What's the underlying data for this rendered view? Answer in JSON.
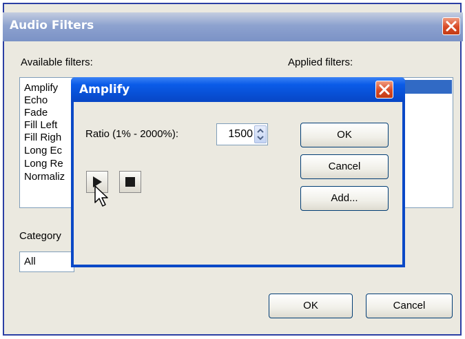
{
  "outer": {
    "title": "Audio Filters",
    "available_label": "Available filters:",
    "applied_label": "Applied filters:",
    "available_filters": [
      "Amplify",
      "Echo",
      "Fade",
      "Fill Left",
      "Fill Righ",
      "Long Ec",
      "Long Re",
      "Normaliz"
    ],
    "category_label": "Category",
    "category_value": "All",
    "ok_label": "OK",
    "cancel_label": "Cancel"
  },
  "dialog": {
    "title": "Amplify",
    "ratio_label": "Ratio (1% - 2000%):",
    "ratio_value": "1500",
    "ok_label": "OK",
    "cancel_label": "Cancel",
    "add_label": "Add..."
  },
  "icons": {
    "close": "close-icon",
    "play": "play-icon",
    "stop": "stop-icon",
    "spin": "spin-arrows-icon",
    "cursor": "mouse-cursor-icon"
  },
  "colors": {
    "title_blue": "#0a49c7",
    "close_red": "#d84a26",
    "face": "#ebe9e0"
  }
}
